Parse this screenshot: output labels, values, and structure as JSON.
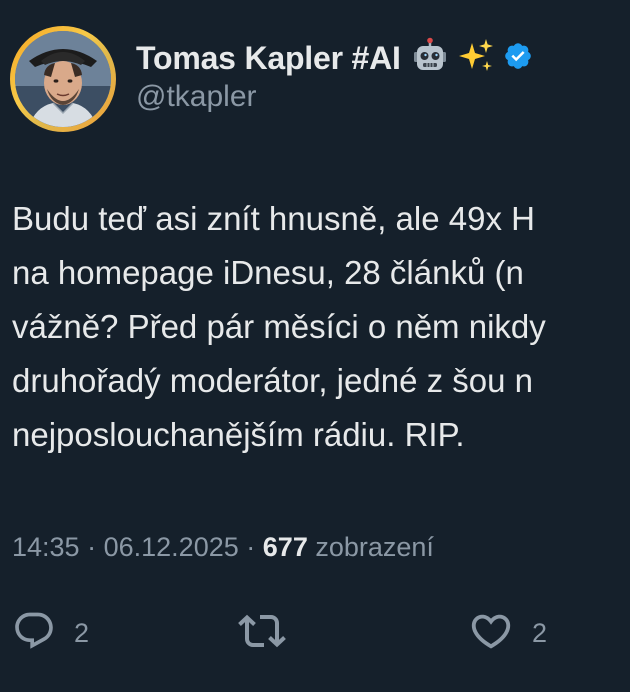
{
  "author": {
    "display_name": "Tomas Kapler #AI",
    "handle": "@tkapler",
    "name_emojis": [
      "robot-emoji",
      "sparkles-emoji"
    ],
    "verified": true
  },
  "tweet": {
    "lines": [
      "Budu teď asi znít hnusně, ale 49x H",
      "na homepage iDnesu, 28 článků (n",
      "vážně? Před pár měsíci o něm nikdy",
      "druhořadý moderátor, jedné z šou n",
      "nejposlouchanějším rádiu. RIP."
    ]
  },
  "meta": {
    "time": "14:35",
    "separator": "·",
    "date": "06.12.2025",
    "views_count": "677",
    "views_label": "zobrazení"
  },
  "actions": {
    "replies": "2",
    "retweets": "",
    "likes": "2"
  },
  "colors": {
    "background": "#15202b",
    "text_primary": "#e7e9ea",
    "text_secondary": "#8b98a5",
    "verified_blue": "#1d9bf0",
    "avatar_ring": "#f5a623"
  }
}
